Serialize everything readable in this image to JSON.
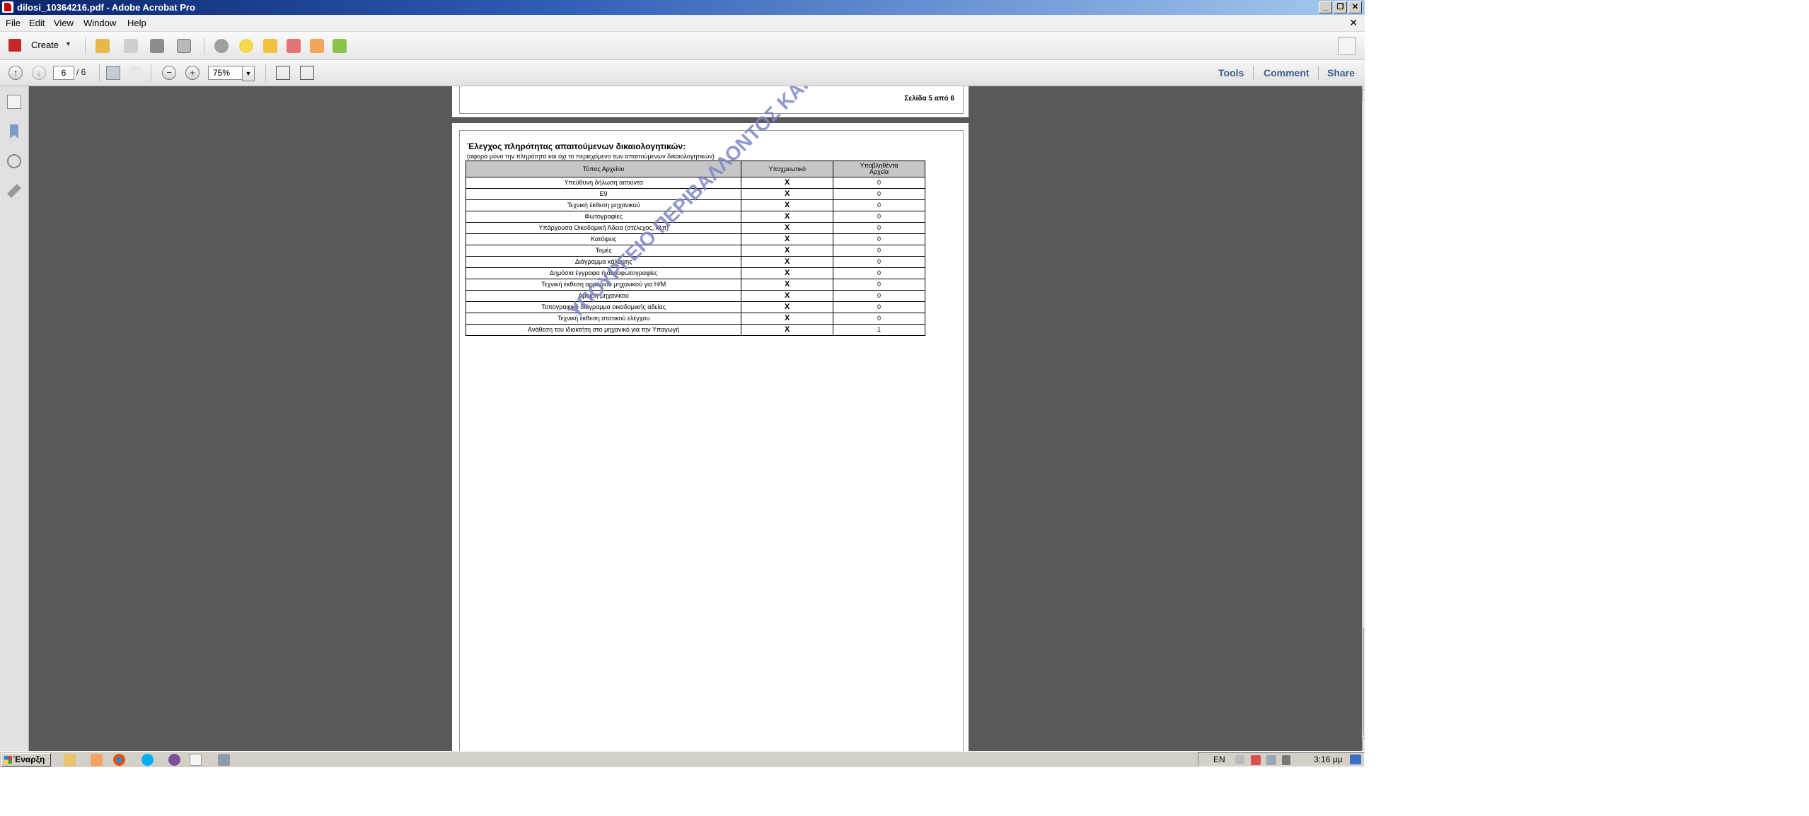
{
  "window": {
    "title": "dilosi_10364216.pdf - Adobe Acrobat Pro"
  },
  "menu": [
    "File",
    "Edit",
    "View",
    "Window",
    "Help"
  ],
  "toolbar": {
    "create_label": "Create"
  },
  "nav": {
    "current_page": "6",
    "total_pages": "/ 6",
    "zoom": "75%",
    "tools": "Tools",
    "comment": "Comment",
    "share": "Share"
  },
  "document": {
    "prev_page_footer": "Σελίδα 5 από 6",
    "section_title": "Έλεγχος πληρότητας απαιτούμενων δικαιολογητικών:",
    "section_subtitle": "(αφορά μόνο την πληρότητα και όχι το περιεχόμενο των απαιτούμενων δικαιολογητικών)",
    "table": {
      "headers": {
        "type": "Τύπος Αρχείου",
        "mandatory": "Υποχρεωτικό",
        "uploaded_line1": "Υποβληθέντα",
        "uploaded_line2": "Αρχεία"
      },
      "rows": [
        {
          "type": "Υπεύθυνη δήλωση  αιτούντα",
          "mandatory": "X",
          "uploaded": "0"
        },
        {
          "type": "Ε9",
          "mandatory": "X",
          "uploaded": "0"
        },
        {
          "type": "Τεχνική έκθεση μηχανικού",
          "mandatory": "X",
          "uploaded": "0"
        },
        {
          "type": "Φωτογραφίες",
          "mandatory": "X",
          "uploaded": "0"
        },
        {
          "type": "Υπάρχουσα Οικοδομική Άδεια (στέλεχος,  κλπ)",
          "mandatory": "X",
          "uploaded": "0"
        },
        {
          "type": "Κατόψεις",
          "mandatory": "X",
          "uploaded": "0"
        },
        {
          "type": "Τομές",
          "mandatory": "X",
          "uploaded": "0"
        },
        {
          "type": "Διάγραμμα κάλυψης",
          "mandatory": "X",
          "uploaded": "0"
        },
        {
          "type": "Δημόσια έγγραφα ή αεροφωτογραφίες",
          "mandatory": "X",
          "uploaded": "0"
        },
        {
          "type": "Τεχνική έκθεση αρμόδιου μηχανικού για Η/Μ",
          "mandatory": "X",
          "uploaded": "0"
        },
        {
          "type": "Αμοιβή μηχανικού",
          "mandatory": "X",
          "uploaded": "0"
        },
        {
          "type": "Τοπογραφικό διάγραμμα οικοδομικής αδείας",
          "mandatory": "X",
          "uploaded": "0"
        },
        {
          "type": "Τεχνική έκθεση στατικού ελέγχου",
          "mandatory": "X",
          "uploaded": "0"
        },
        {
          "type": "Ανάθεση του ιδιοκτήτη στο μηχανικό για την  Υπαγωγή",
          "mandatory": "X",
          "uploaded": "1"
        }
      ]
    },
    "watermark": "ΥΠΟΥΡΓΕΙΟ ΠΕΡΙΒΑΛΛΟΝΤΟΣ ΚΑΙ ΕΝΕΡΓΕΙΑΣ",
    "watermark_color": "#7e86c6"
  },
  "taskbar": {
    "start_label": "Έναρξη",
    "language": "EN",
    "clock": "3:16 μμ"
  },
  "colors": {
    "accent_link": "#3d5e8f",
    "document_bg": "#595959",
    "title_bar": "#0a246a"
  }
}
